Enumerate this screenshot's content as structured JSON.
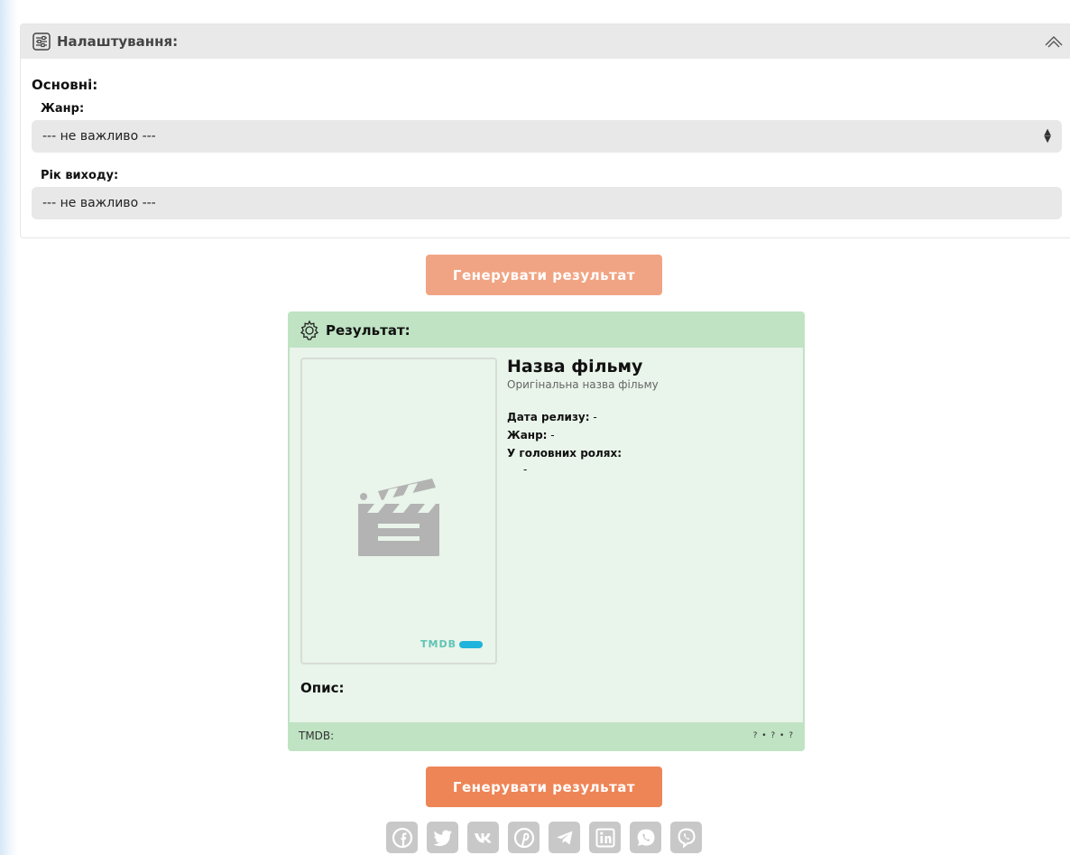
{
  "settings": {
    "title": "Налаштування:",
    "section_title": "Основні:",
    "genre_label": "Жанр:",
    "genre_value": "--- не важливо ---",
    "year_label": "Рік виходу:",
    "year_value": "--- не важливо ---"
  },
  "buttons": {
    "generate_label": "Генерувати результат"
  },
  "result": {
    "title": "Результат:",
    "movie_title": "Назва фільму",
    "original_title": "Оригінальна назва фільму",
    "release_label": "Дата релизу:",
    "release_value": "-",
    "genre_label": "Жанр:",
    "genre_value": "-",
    "cast_label": "У головних ролях:",
    "cast_value": "-",
    "description_label": "Опис:",
    "tmdb_badge": "TMDB",
    "footer_left": "TMDB:",
    "footer_right": "? • ? • ?"
  },
  "social": {
    "icons": [
      "facebook-icon",
      "twitter-icon",
      "vk-icon",
      "pinterest-icon",
      "telegram-icon",
      "linkedin-icon",
      "whatsapp-icon",
      "viber-icon"
    ]
  },
  "colors": {
    "generate_button_light": "#f1a483",
    "generate_button": "#ee8557",
    "result_header": "#bfe3c3",
    "result_background": "#e9f4ea",
    "tmdb_accent": "#1fb4dc",
    "social_button": "#c8c8c8"
  }
}
